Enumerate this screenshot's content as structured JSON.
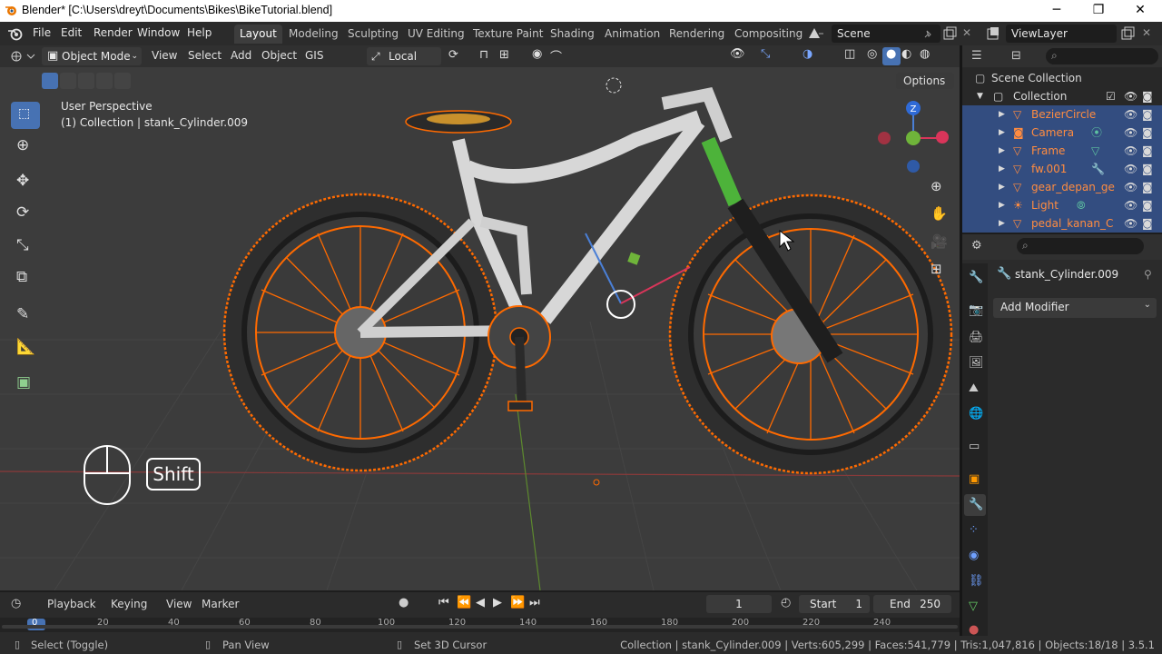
{
  "window": {
    "title": "Blender* [C:\\Users\\dreyt\\Documents\\Bikes\\BikeTutorial.blend]",
    "minimize_glyph": "─",
    "restore_glyph": "❐",
    "close_glyph": "✕"
  },
  "menu": [
    "File",
    "Edit",
    "Render",
    "Window",
    "Help"
  ],
  "workspaces": [
    "Layout",
    "Modeling",
    "Sculpting",
    "UV Editing",
    "Texture Paint",
    "Shading",
    "Animation",
    "Rendering",
    "Compositing"
  ],
  "active_workspace": "Layout",
  "scene_name": "Scene",
  "view_layer": "ViewLayer",
  "viewport_header": {
    "mode": "Object Mode",
    "menus": [
      "View",
      "Select",
      "Add",
      "Object",
      "GIS"
    ],
    "transform_orientation": "Local",
    "options_label": "Options"
  },
  "viewport": {
    "perspective_label": "User Perspective",
    "collection_label": "(1) Collection | stank_Cylinder.009",
    "shift_key": "Shift",
    "gizmo_z": "Z"
  },
  "outliner": {
    "scene_collection": "Scene Collection",
    "collection": "Collection",
    "items": [
      "BezierCircle",
      "Camera",
      "Frame",
      "fw.001",
      "gear_depan_ge",
      "Light",
      "pedal_kanan_C"
    ]
  },
  "properties": {
    "object_name": "stank_Cylinder.009",
    "add_modifier": "Add Modifier"
  },
  "timeline": {
    "menus": [
      "Playback",
      "Keying",
      "View",
      "Marker"
    ],
    "current_frame": "1",
    "start_label": "Start",
    "start": "1",
    "end_label": "End",
    "end": "250",
    "ruler": [
      "0",
      "20",
      "40",
      "60",
      "80",
      "100",
      "120",
      "140",
      "160",
      "180",
      "200",
      "220",
      "240"
    ]
  },
  "statusbar": {
    "select": "Select (Toggle)",
    "pan": "Pan View",
    "cursor": "Set 3D Cursor",
    "stats": "Collection | stank_Cylinder.009 | Verts:605,299 | Faces:541,779 | Tris:1,047,816 | Objects:18/18 | 3.5.1"
  },
  "colors": {
    "accent": "#4772b3",
    "selection_orange": "#ff6a00",
    "active_yellow": "#ffaa33",
    "outliner_item": "#ff8c40"
  }
}
